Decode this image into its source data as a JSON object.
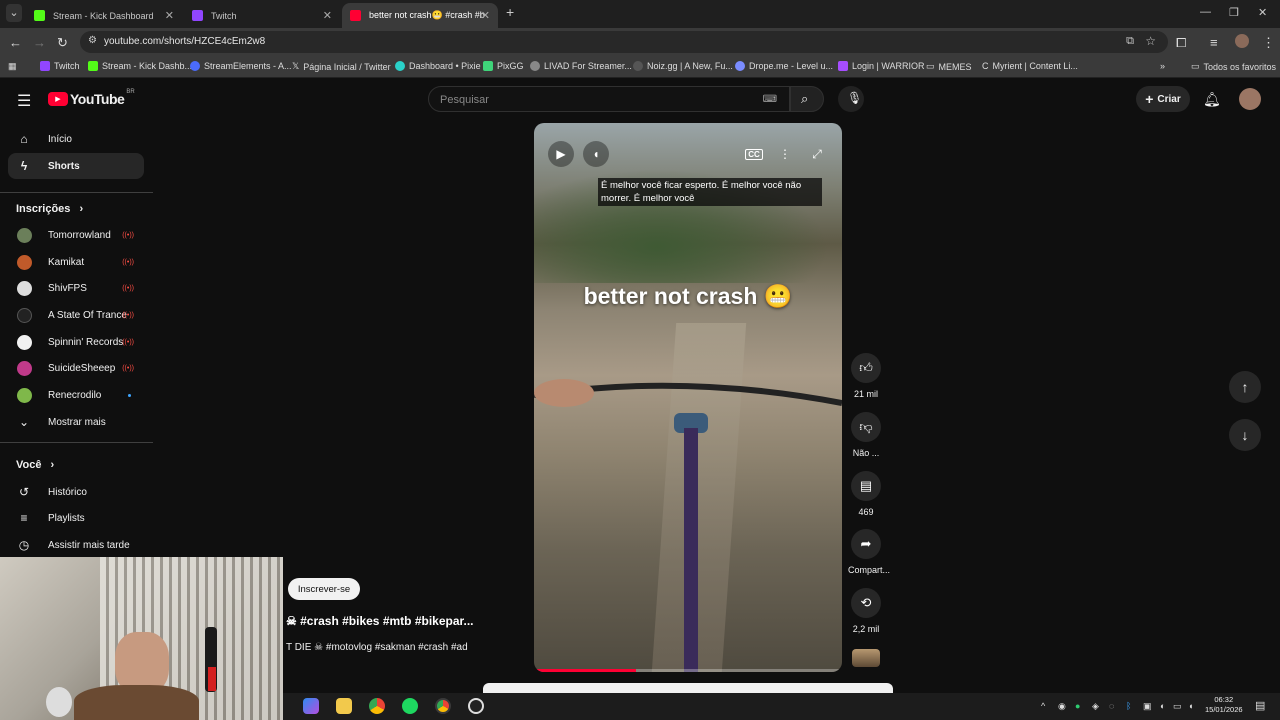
{
  "browser": {
    "tabs": [
      {
        "title": "Stream - Kick Dashboard",
        "color": "#53fc18"
      },
      {
        "title": "Twitch",
        "color": "#9146ff"
      },
      {
        "title": "better not crash😬 #crash #b",
        "color": "#ff0033"
      }
    ],
    "url": "youtube.com/shorts/HZCE4cEm2w8",
    "bookmarks": [
      {
        "label": "Twitch",
        "color": "#9146ff"
      },
      {
        "label": "Stream - Kick Dashb...",
        "color": "#53fc18"
      },
      {
        "label": "StreamElements - A...",
        "color": "#4b6bfb"
      },
      {
        "label": "Página Inicial / Twitter",
        "color": "#dddddd"
      },
      {
        "label": "Dashboard • Pixie",
        "color": "#2ad1c9"
      },
      {
        "label": "PixGG",
        "color": "#3fd47a"
      },
      {
        "label": "LIVAD For Streamer...",
        "color": "#cccccc"
      },
      {
        "label": "Noiz.gg | A New, Fu...",
        "color": "#cccccc"
      },
      {
        "label": "Drope.me - Level u...",
        "color": "#7a8cff"
      },
      {
        "label": "Login | WARRIOR",
        "color": "#a64dff"
      },
      {
        "label": "MEMES",
        "color": "#cccccc"
      },
      {
        "label": "Myrient | Content Li...",
        "color": "#cccccc"
      }
    ],
    "all_bookmarks": "Todos os favoritos"
  },
  "youtube": {
    "logo_text": "YouTube",
    "region": "BR",
    "search_placeholder": "Pesquisar",
    "create_label": "Criar",
    "sidebar": {
      "home": "Início",
      "shorts": "Shorts",
      "subscriptions_header": "Inscrições",
      "subscriptions": [
        {
          "name": "Tomorrowland",
          "status": "live",
          "color": "#6b7f5a"
        },
        {
          "name": "Kamikat",
          "status": "live",
          "color": "#c05a2a"
        },
        {
          "name": "ShivFPS",
          "status": "live",
          "color": "#dddddd"
        },
        {
          "name": "A State Of Trance",
          "status": "live",
          "color": "#222222"
        },
        {
          "name": "Spinnin' Records",
          "status": "live",
          "color": "#f1f1f1"
        },
        {
          "name": "SuicideSheeep",
          "status": "live",
          "color": "#c03a8a"
        },
        {
          "name": "Renecrodilo",
          "status": "new",
          "color": "#7fb84a"
        }
      ],
      "show_more": "Mostrar mais",
      "you_header": "Você",
      "history": "Histórico",
      "playlists": "Playlists",
      "watch_later": "Assistir mais tarde"
    },
    "short": {
      "caption": "É melhor você ficar esperto.  É melhor você não morrer.  É melhor você",
      "overlay_title": "better not crash 😬",
      "progress": 0.33,
      "subscribe_label": "Inscrever-se",
      "title": "☠ #crash #bikes #mtb #bikepar...",
      "description": "T DIE ☠ #motovlog #sakman #crash #ad",
      "actions": {
        "likes": "21 mil",
        "dislike": "Não ...",
        "comments": "469",
        "share": "Compart...",
        "remix": "2,2 mil"
      }
    }
  },
  "taskbar": {
    "time": "06:32",
    "date": "15/01/2026"
  }
}
